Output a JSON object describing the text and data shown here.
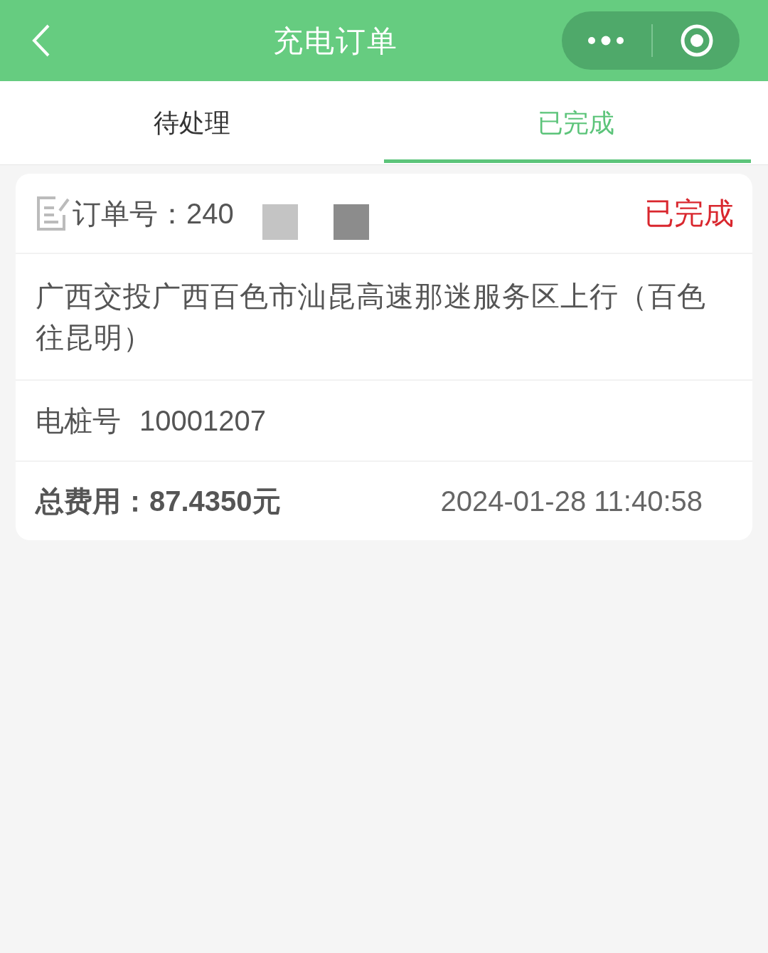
{
  "header": {
    "title": "充电订单"
  },
  "tabs": [
    {
      "label": "待处理",
      "selected": false
    },
    {
      "label": "已完成",
      "selected": true
    }
  ],
  "order": {
    "number_label": "订单号：",
    "number": "240",
    "status": "已完成",
    "station": "广西交投广西百色市汕昆高速那迷服务区上行（百色往昆明）",
    "pile_label": "电桩号",
    "pile": "10001207",
    "total_label": "总费用：",
    "total": "87.4350元",
    "time": "2024-01-28 11:40:58"
  }
}
